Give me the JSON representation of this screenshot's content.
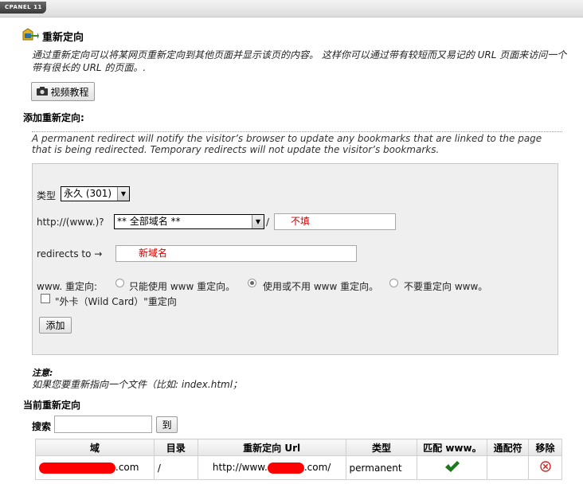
{
  "header": {
    "brand": "CPANEL 11"
  },
  "page": {
    "title": "重新定向",
    "description": "通过重新定向可以将某网页重新定向到其他页面并显示该页的内容。 这样你可以通过带有较短而又易记的 URL 页面来访问一个带有很长的 URL 的页面。.",
    "video_button": "视频教程"
  },
  "add_section": {
    "title": "添加重新定向:",
    "note": "A permanent redirect will notify the visitor’s browser to update any bookmarks that are linked to the page that is being redirected. Temporary redirects will not update the visitor’s bookmarks."
  },
  "form": {
    "type_label": "类型",
    "type_value": "永久 (301)",
    "url_prefix": "http://(www.)?",
    "domain_value": "** 全部域名 **",
    "slash": "/",
    "path_value": "不填",
    "redirect_label": "redirects to →",
    "redirect_value": "新域名",
    "www_label": "www. 重定向:",
    "www_options": [
      "只能使用 www 重定向。",
      "使用或不用 www 重定向。",
      "不要重定向 www。"
    ],
    "www_selected": 1,
    "wildcard_label": "\"外卡（Wild Card）\"重定向",
    "add_button": "添加"
  },
  "tip": {
    "title": "注意:",
    "text": "如果您要重新指向一个文件（比如: index.html；"
  },
  "current": {
    "title": "当前重新定向",
    "search_label": "搜索",
    "go_button": "到",
    "columns": [
      "域",
      "目录",
      "重新定向 Url",
      "类型",
      "匹配 www。",
      "通配符",
      "移除"
    ],
    "rows": [
      {
        "domain_suffix": ".com",
        "dir": "/",
        "redirect_prefix": "http://www.",
        "redirect_suffix": ".com/",
        "type": "permanent"
      }
    ]
  },
  "colors": {
    "redaction": "#ff0000",
    "placeholder_red": "#cc0000",
    "check_green": "#1a7a1a",
    "remove_red": "#d42a2a"
  },
  "icons": [
    "redirect-page-icon",
    "camera-icon",
    "chevron-down-icon",
    "checkmark-icon",
    "remove-icon"
  ]
}
